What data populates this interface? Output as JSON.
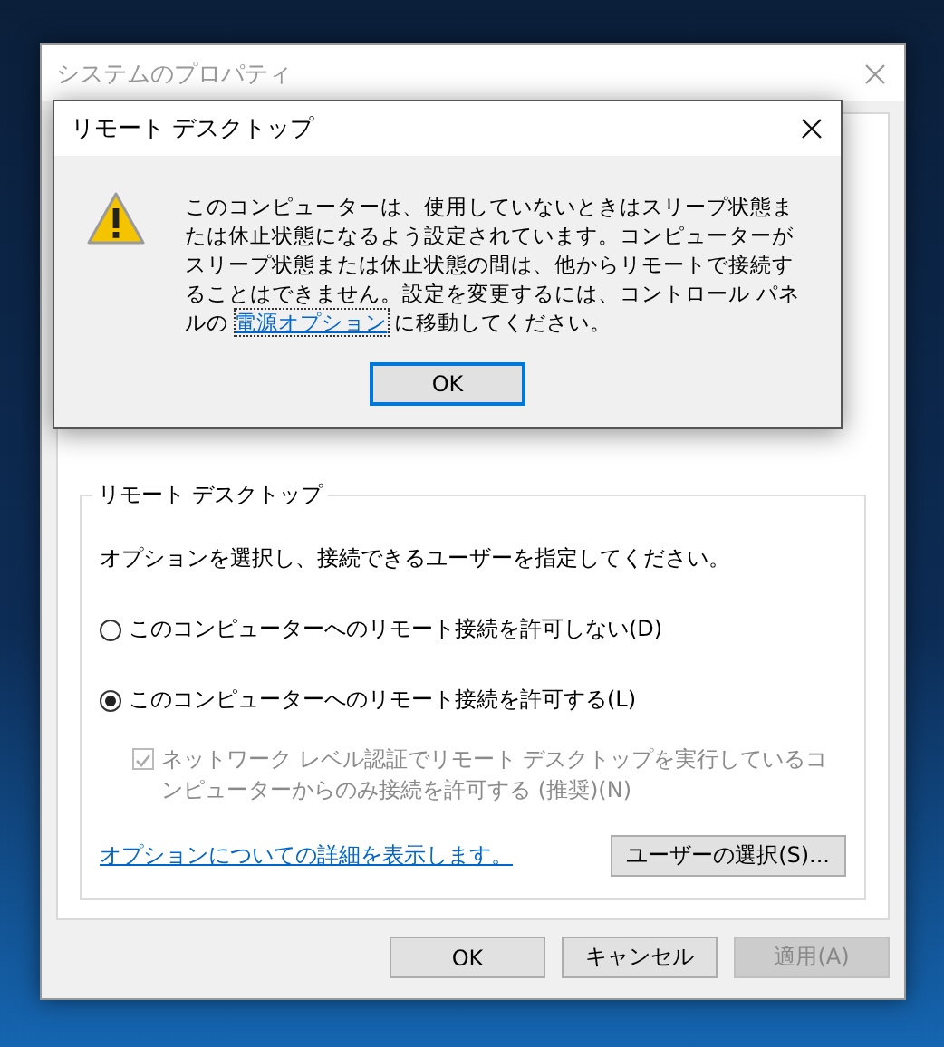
{
  "background_window": {
    "title": "システムのプロパティ",
    "group": {
      "title": "リモート デスクトップ",
      "instruction": "オプションを選択し、接続できるユーザーを指定してください。",
      "options": [
        {
          "label": "このコンピューターへのリモート接続を許可しない(D)",
          "selected": false
        },
        {
          "label": "このコンピューターへのリモート接続を許可する(L)",
          "selected": true
        }
      ],
      "nla_checkbox": {
        "label": "ネットワーク レベル認証でリモート デスクトップを実行しているコンピューターからのみ接続を許可する (推奨)(N)",
        "checked": true,
        "disabled": true
      },
      "help_link": "オプションについての詳細を表示します。",
      "select_users_button": "ユーザーの選択(S)..."
    },
    "buttons": [
      {
        "label": "OK",
        "disabled": false
      },
      {
        "label": "キャンセル",
        "disabled": false
      },
      {
        "label": "適用(A)",
        "disabled": true
      }
    ]
  },
  "dialog": {
    "title": "リモート デスクトップ",
    "message_before": "このコンピューターは、使用していないときはスリープ状態または休止状態になるよう設定されています。コンピューターがスリープ状態または休止状態の間は、他からリモートで接続することはできません。設定を変更するには、コントロール パネルの ",
    "link": "電源オプション",
    "message_after": " に移動してください。",
    "ok_button": "OK"
  }
}
